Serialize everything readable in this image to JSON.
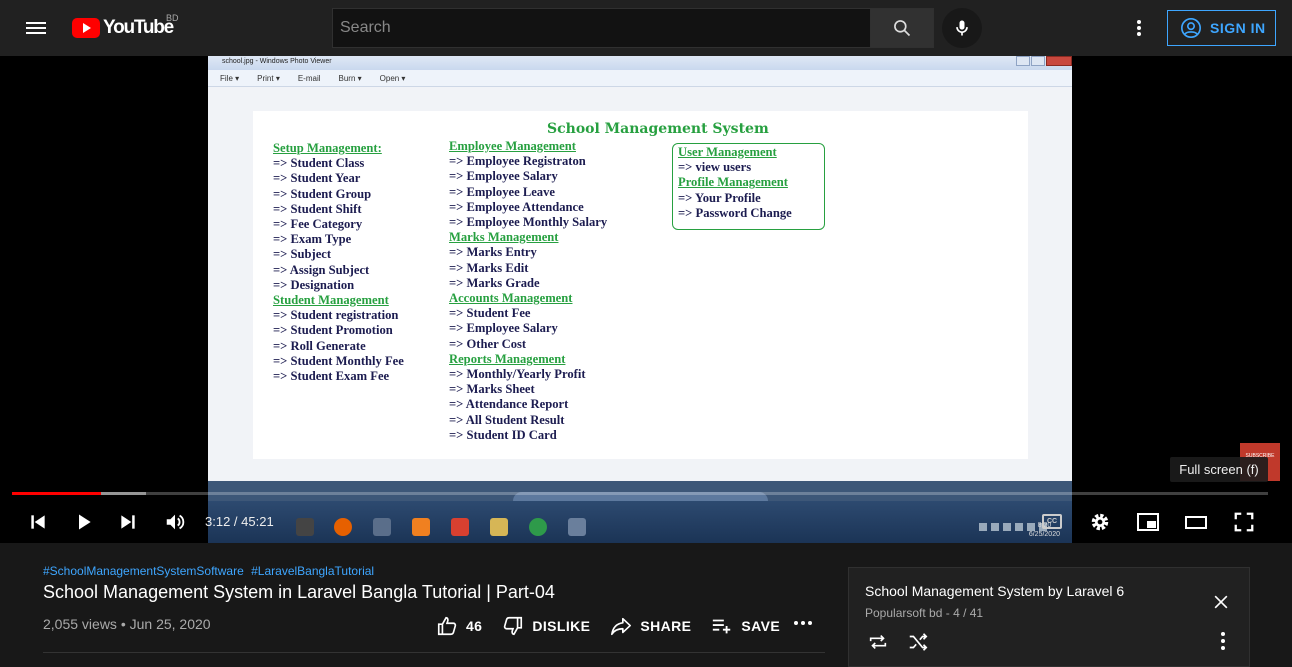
{
  "header": {
    "logo_text": "YouTube",
    "country_code": "BD",
    "search_placeholder": "Search",
    "signin_label": "SIGN IN"
  },
  "player": {
    "photo_viewer": {
      "window_title": "school.jpg - Windows Photo Viewer",
      "menu": [
        "File ▾",
        "Print ▾",
        "E-mail",
        "Burn ▾",
        "Open ▾"
      ],
      "sheet_title": "School Management System",
      "column1": [
        {
          "text": "Setup Management:",
          "heading": true
        },
        {
          "text": "=> Student Class"
        },
        {
          "text": "=> Student Year"
        },
        {
          "text": "=> Student Group"
        },
        {
          "text": "=> Student Shift"
        },
        {
          "text": "=> Fee Category"
        },
        {
          "text": "=> Exam Type"
        },
        {
          "text": "=> Subject"
        },
        {
          "text": "=> Assign Subject"
        },
        {
          "text": "=> Designation"
        },
        {
          "text": "Student Management",
          "heading": true
        },
        {
          "text": "=> Student registration"
        },
        {
          "text": "=> Student Promotion"
        },
        {
          "text": "=> Roll Generate"
        },
        {
          "text": "=> Student Monthly Fee"
        },
        {
          "text": "=> Student Exam Fee"
        }
      ],
      "column2": [
        {
          "text": "Employee Management",
          "heading": true
        },
        {
          "text": "=> Employee Registraton"
        },
        {
          "text": "=> Employee Salary"
        },
        {
          "text": "=> Employee Leave"
        },
        {
          "text": "=> Employee Attendance"
        },
        {
          "text": "=> Employee Monthly Salary"
        },
        {
          "text": "Marks Management",
          "heading": true
        },
        {
          "text": "=> Marks Entry"
        },
        {
          "text": "=> Marks Edit"
        },
        {
          "text": "=> Marks Grade"
        },
        {
          "text": "Accounts Management",
          "heading": true
        },
        {
          "text": "=> Student Fee"
        },
        {
          "text": "=> Employee Salary"
        },
        {
          "text": "=> Other Cost"
        },
        {
          "text": "Reports Management",
          "heading": true
        },
        {
          "text": "=> Monthly/Yearly Profit"
        },
        {
          "text": "=> Marks Sheet"
        },
        {
          "text": "=> Attendance Report"
        },
        {
          "text": "=> All Student Result"
        },
        {
          "text": "=> Student ID Card"
        }
      ],
      "column3": [
        {
          "text": "User Management",
          "heading": true
        },
        {
          "text": "=> view users"
        },
        {
          "text": "Profile Management",
          "heading": true
        },
        {
          "text": "=> Your Profile"
        },
        {
          "text": "=> Password Change"
        }
      ],
      "taskbar_time": "8:20",
      "taskbar_date": "6/25/2020"
    },
    "watermark_text": "SUBSCRIBE",
    "tooltip": "Full screen (f)",
    "time_display": "3:12 / 45:21",
    "progress": {
      "played_fraction": 0.0706,
      "buffered_fraction": 0.107
    },
    "cc_label": "CC"
  },
  "video": {
    "hashtags": [
      "#SchoolManagementSystemSoftware",
      "#LaravelBanglaTutorial"
    ],
    "title": "School Management System in Laravel Bangla Tutorial | Part-04",
    "views_date": "2,055 views • Jun 25, 2020",
    "likes": "46",
    "dislike_label": "DISLIKE",
    "share_label": "SHARE",
    "save_label": "SAVE"
  },
  "playlist": {
    "title": "School Management System by Laravel 6",
    "channel": "Popularsoft bd",
    "position": "- 4 / 41"
  }
}
